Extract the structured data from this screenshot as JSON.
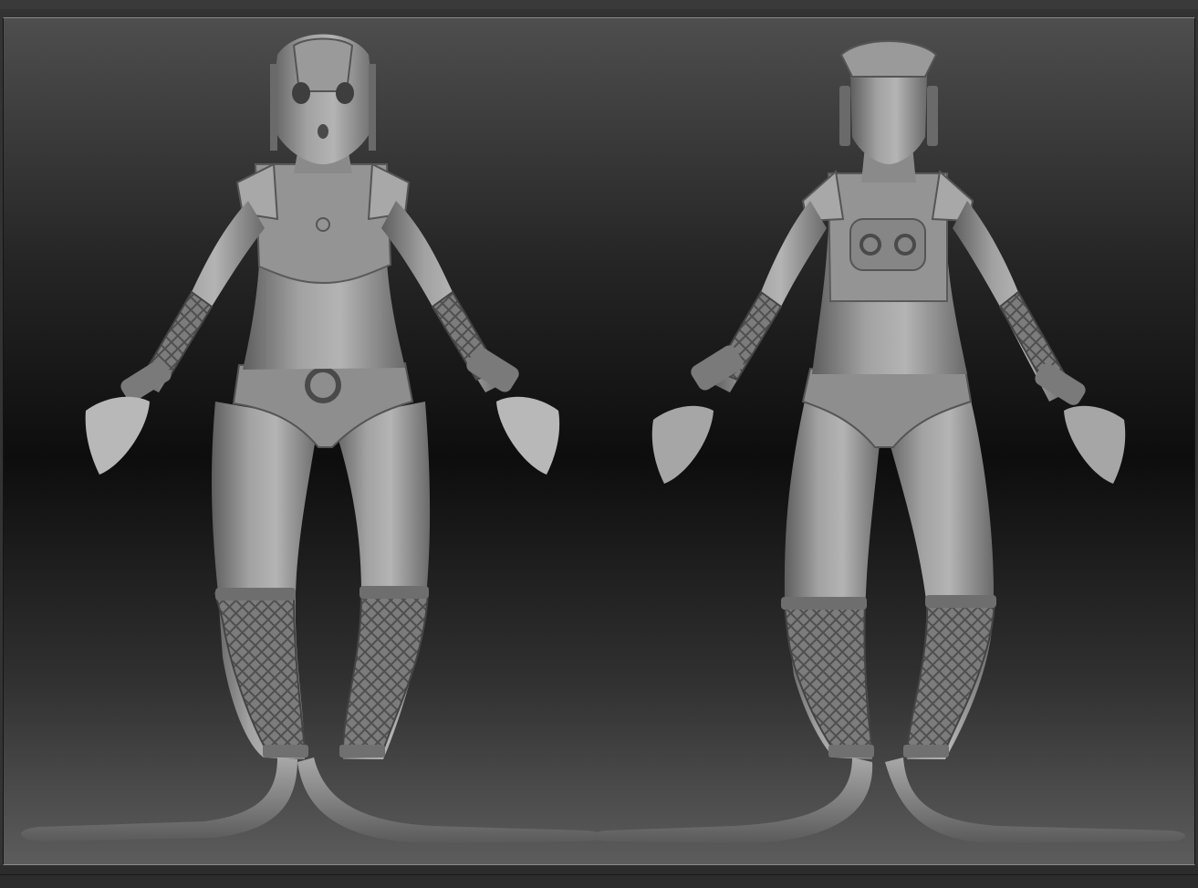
{
  "app": {
    "viewport": "3d-canvas",
    "background_gradient": [
      "#4e4e4e",
      "#0d0d0d",
      "#5c5c5c"
    ],
    "material_color": "#8c8c8c"
  },
  "models": [
    {
      "view": "front",
      "icon": "sculpt-figure-front"
    },
    {
      "view": "back",
      "icon": "sculpt-figure-back"
    }
  ]
}
